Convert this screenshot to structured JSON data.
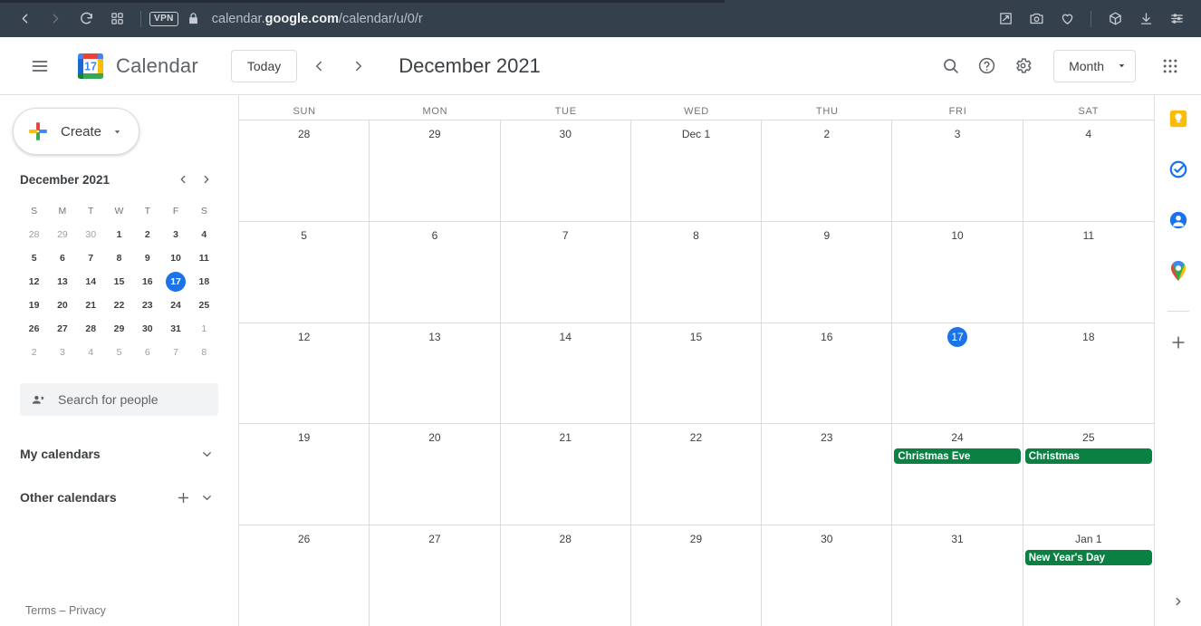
{
  "browser": {
    "url_prefix": "calendar.",
    "url_domain": "google.com",
    "url_suffix": "/calendar/u/0/r",
    "vpn_label": "VPN",
    "icons": {
      "back": "back-arrow-icon",
      "forward": "forward-arrow-icon",
      "reload": "reload-icon",
      "grid": "tab-grid-icon",
      "lock": "lock-icon",
      "pin": "pin-icon",
      "camera": "camera-icon",
      "heart": "heart-icon",
      "cube": "cube-icon",
      "download": "download-icon",
      "sliders": "sliders-icon"
    }
  },
  "header": {
    "menu_icon": "hamburger-menu-icon",
    "logo_day": "17",
    "brand": "Calendar",
    "today_label": "Today",
    "date_title": "December 2021",
    "search_icon": "search-icon",
    "help_icon": "help-icon",
    "settings_icon": "gear-icon",
    "view_label": "Month",
    "apps_icon": "apps-grid-icon"
  },
  "sidebar": {
    "create_label": "Create",
    "mini_calendar": {
      "title": "December 2021",
      "dow": [
        "S",
        "M",
        "T",
        "W",
        "T",
        "F",
        "S"
      ],
      "weeks": [
        [
          {
            "n": "28",
            "muted": true
          },
          {
            "n": "29",
            "muted": true
          },
          {
            "n": "30",
            "muted": true
          },
          {
            "n": "1"
          },
          {
            "n": "2"
          },
          {
            "n": "3"
          },
          {
            "n": "4"
          }
        ],
        [
          {
            "n": "5"
          },
          {
            "n": "6"
          },
          {
            "n": "7"
          },
          {
            "n": "8"
          },
          {
            "n": "9"
          },
          {
            "n": "10"
          },
          {
            "n": "11"
          }
        ],
        [
          {
            "n": "12"
          },
          {
            "n": "13"
          },
          {
            "n": "14"
          },
          {
            "n": "15"
          },
          {
            "n": "16"
          },
          {
            "n": "17",
            "today": true
          },
          {
            "n": "18"
          }
        ],
        [
          {
            "n": "19"
          },
          {
            "n": "20"
          },
          {
            "n": "21"
          },
          {
            "n": "22"
          },
          {
            "n": "23"
          },
          {
            "n": "24"
          },
          {
            "n": "25"
          }
        ],
        [
          {
            "n": "26"
          },
          {
            "n": "27"
          },
          {
            "n": "28"
          },
          {
            "n": "29"
          },
          {
            "n": "30"
          },
          {
            "n": "31"
          },
          {
            "n": "1",
            "muted": true
          }
        ],
        [
          {
            "n": "2",
            "muted": true
          },
          {
            "n": "3",
            "muted": true
          },
          {
            "n": "4",
            "muted": true
          },
          {
            "n": "5",
            "muted": true
          },
          {
            "n": "6",
            "muted": true
          },
          {
            "n": "7",
            "muted": true
          },
          {
            "n": "8",
            "muted": true
          }
        ]
      ]
    },
    "search_people_placeholder": "Search for people",
    "my_calendars_label": "My calendars",
    "other_calendars_label": "Other calendars",
    "footer": {
      "terms": "Terms",
      "separator": "–",
      "privacy": "Privacy"
    }
  },
  "calendar": {
    "day_headers": [
      "SUN",
      "MON",
      "TUE",
      "WED",
      "THU",
      "FRI",
      "SAT"
    ],
    "event_color": "#0b8043",
    "today_color": "#1a73e8",
    "weeks": [
      [
        {
          "label": "28"
        },
        {
          "label": "29"
        },
        {
          "label": "30"
        },
        {
          "label": "Dec 1"
        },
        {
          "label": "2"
        },
        {
          "label": "3"
        },
        {
          "label": "4"
        }
      ],
      [
        {
          "label": "5"
        },
        {
          "label": "6"
        },
        {
          "label": "7"
        },
        {
          "label": "8"
        },
        {
          "label": "9"
        },
        {
          "label": "10"
        },
        {
          "label": "11"
        }
      ],
      [
        {
          "label": "12"
        },
        {
          "label": "13"
        },
        {
          "label": "14"
        },
        {
          "label": "15"
        },
        {
          "label": "16"
        },
        {
          "label": "17",
          "today": true
        },
        {
          "label": "18"
        }
      ],
      [
        {
          "label": "19"
        },
        {
          "label": "20"
        },
        {
          "label": "21"
        },
        {
          "label": "22"
        },
        {
          "label": "23"
        },
        {
          "label": "24",
          "events": [
            {
              "title": "Christmas Eve",
              "color": "#0b8043"
            }
          ]
        },
        {
          "label": "25",
          "events": [
            {
              "title": "Christmas",
              "color": "#0b8043"
            }
          ]
        }
      ],
      [
        {
          "label": "26"
        },
        {
          "label": "27"
        },
        {
          "label": "28"
        },
        {
          "label": "29"
        },
        {
          "label": "30"
        },
        {
          "label": "31"
        },
        {
          "label": "Jan 1",
          "events": [
            {
              "title": "New Year's Day",
              "color": "#0b8043"
            }
          ]
        }
      ]
    ]
  },
  "right_rail": {
    "items": [
      {
        "name": "keep-icon"
      },
      {
        "name": "tasks-icon"
      },
      {
        "name": "contacts-icon"
      },
      {
        "name": "maps-icon"
      }
    ],
    "add_icon": "add-icon",
    "expand_icon": "chevron-right-icon"
  }
}
